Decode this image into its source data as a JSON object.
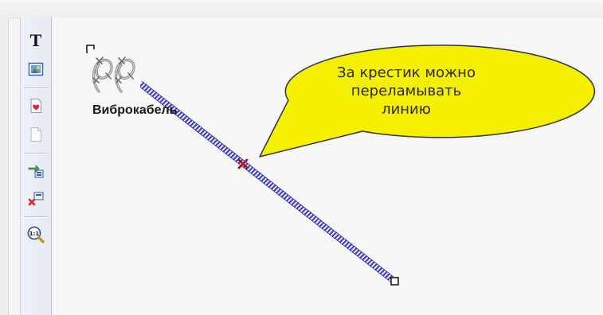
{
  "node": {
    "label": "Виброкабель",
    "icon": "barbed-wire-icon"
  },
  "callout": {
    "lines": [
      "За крестик можно",
      "переламывать",
      "линию"
    ],
    "fill": "#f4f000",
    "stroke": "#333333"
  },
  "line": {
    "color": "#3c3cc8",
    "break_marker_color": "#a01818"
  },
  "toolbar": {
    "items": [
      {
        "name": "text-tool",
        "icon": "text-T-icon",
        "glyph": "T"
      },
      {
        "name": "image-tool",
        "icon": "picture-icon"
      },
      {
        "name": "heart-page-tool",
        "icon": "heart-page-icon"
      },
      {
        "name": "blank-page-tool",
        "icon": "blank-page-icon"
      },
      {
        "name": "connect-tool",
        "icon": "connect-arrows-icon"
      },
      {
        "name": "disconnect-tool",
        "icon": "disconnect-icon"
      },
      {
        "name": "zoom-actual-tool",
        "icon": "zoom-1-1-icon",
        "glyph": "1:1"
      }
    ]
  }
}
